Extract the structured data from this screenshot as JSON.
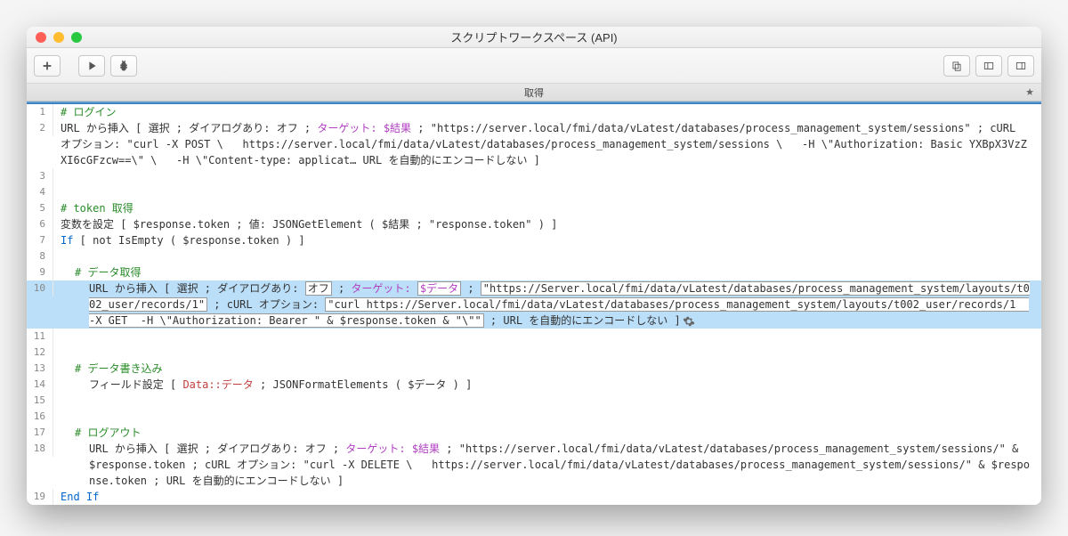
{
  "window": {
    "title": "スクリプトワークスペース (API)"
  },
  "tab": {
    "name": "取得",
    "star": "★"
  },
  "toolbar": {
    "add": "add",
    "run": "run",
    "debug": "debug",
    "copy": "copy",
    "sidebar_l": "sidebar-left",
    "sidebar_r": "sidebar-right"
  },
  "lines": [
    {
      "n": "1",
      "indent": 0,
      "html": "<span class='comment'># ログイン</span>"
    },
    {
      "n": "2",
      "indent": 0,
      "html": "URL から挿入 [ 選択 ; ダイアログあり: オフ ; <span class='target'>ターゲット: $結果</span> ; \"https://server.local/fmi/data/vLatest/databases/process_management_system/sessions\" ; cURL オプション: \"curl -X POST \\   https://server.local/fmi/data/vLatest/databases/process_management_system/sessions \\   -H \\\"Authorization: Basic YXBpX3VzZXI6cGFzcw==\\\" \\   -H \\\"Content-type: applicat… URL を自動的にエンコードしない ]"
    },
    {
      "n": "3",
      "indent": 0,
      "html": ""
    },
    {
      "n": "4",
      "indent": 0,
      "html": ""
    },
    {
      "n": "5",
      "indent": 0,
      "html": "<span class='comment'># token 取得</span>"
    },
    {
      "n": "6",
      "indent": 0,
      "html": "変数を設定 [ $response.token ; 値: <span class='func'>JSONGetElement</span> ( $結果 ; \"response.token\" ) ]"
    },
    {
      "n": "7",
      "indent": 0,
      "html": "<span class='keyword'>If</span> [ not IsEmpty ( $response.token ) ]"
    },
    {
      "n": "8",
      "indent": 0,
      "html": ""
    },
    {
      "n": "9",
      "indent": 1,
      "html": "<span class='comment'># データ取得</span>"
    },
    {
      "n": "10",
      "indent": 2,
      "selected": true,
      "html": "URL から挿入 [ 選択 ; ダイアログあり: <span class='boxed'>オフ</span> ; <span class='target'>ターゲット: <span class='boxed'>$データ</span></span> ; <span class='boxed'>\"https://Server.local/fmi/data/vLatest/databases/process_management_system/layouts/t002_user/records/1\"</span> ; cURL オプション: <span class='boxed'>\"curl https://Server.local/fmi/data/vLatest/databases/process_management_system/layouts/t002_user/records/1  -X GET  -H \\\"Authorization: Bearer \" & $response.token & \"\\\"\"</span> ; URL を自動的にエンコードしない ]<span class='gear-inline' data-name='gear-icon' data-interactable='true'><svg viewBox='0 0 24 24'><path d='M12 8a4 4 0 100 8 4 4 0 000-8zm9 4a7 7 0 01-.1 1.2l2 1.6-2 3.4-2.4-.8a7 7 0 01-2 1.2l-.4 2.5h-4l-.4-2.5a7 7 0 01-2-1.2l-2.4.8-2-3.4 2-1.6A7 7 0 013 12a7 7 0 01.1-1.2l-2-1.6 2-3.4 2.4.8a7 7 0 012-1.2L8 2.9h4l.4 2.5a7 7 0 012 1.2l2.4-.8 2 3.4-2 1.6c.1.4.2.8.2 1.2z'/></svg></span>"
    },
    {
      "n": "11",
      "indent": 0,
      "html": ""
    },
    {
      "n": "12",
      "indent": 0,
      "html": ""
    },
    {
      "n": "13",
      "indent": 1,
      "html": "<span class='comment'># データ書き込み</span>"
    },
    {
      "n": "14",
      "indent": 2,
      "html": "フィールド設定 [ <span class='field-ref'>Data::データ</span> ; <span class='func'>JSONFormatElements</span> ( $データ ) ]"
    },
    {
      "n": "15",
      "indent": 0,
      "html": ""
    },
    {
      "n": "16",
      "indent": 0,
      "html": ""
    },
    {
      "n": "17",
      "indent": 1,
      "html": "<span class='comment'># ログアウト</span>"
    },
    {
      "n": "18",
      "indent": 2,
      "html": "URL から挿入 [ 選択 ; ダイアログあり: オフ ; <span class='target'>ターゲット: $結果</span> ; \"https://server.local/fmi/data/vLatest/databases/process_management_system/sessions/\" & $response.token ; cURL オプション: \"curl -X DELETE \\   https://server.local/fmi/data/vLatest/databases/process_management_system/sessions/\" & $response.token ; URL を自動的にエンコードしない ]"
    },
    {
      "n": "19",
      "indent": 0,
      "html": "<span class='keyword'>End If</span>"
    }
  ]
}
